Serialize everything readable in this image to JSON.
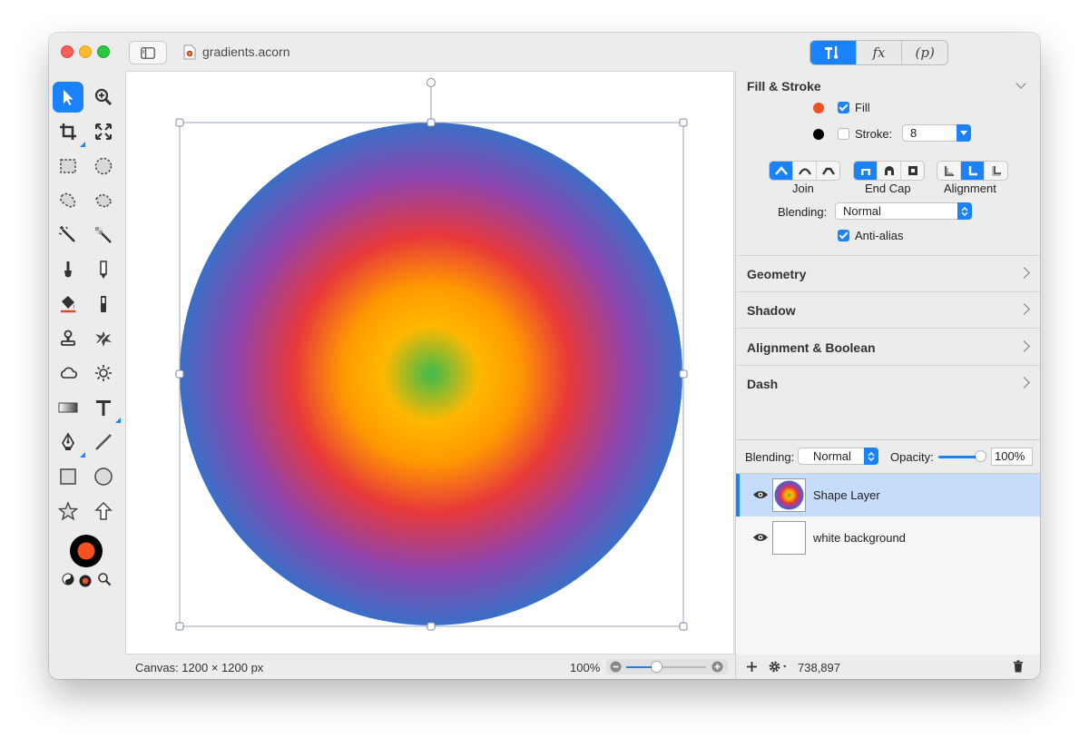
{
  "window": {
    "title": "gradients.acorn"
  },
  "inspector_tabs": [
    "T!",
    "fx",
    "(p)"
  ],
  "fill_stroke": {
    "title": "Fill & Stroke",
    "fill_label": "Fill",
    "fill_checked": true,
    "fill_color": "#f4511e",
    "stroke_label": "Stroke:",
    "stroke_checked": false,
    "stroke_color": "#000000",
    "stroke_width": "8",
    "join_label": "Join",
    "endcap_label": "End Cap",
    "alignment_label": "Alignment",
    "blending_label": "Blending:",
    "blending_value": "Normal",
    "antialias_label": "Anti-alias",
    "antialias_checked": true
  },
  "sections": [
    "Geometry",
    "Shadow",
    "Alignment & Boolean",
    "Dash"
  ],
  "layers_panel": {
    "blending_label": "Blending:",
    "blending_value": "Normal",
    "opacity_label": "Opacity:",
    "opacity_value": "100%",
    "opacity_fraction": 1.0,
    "layers": [
      {
        "name": "Shape Layer",
        "selected": true,
        "visible": true
      },
      {
        "name": "white background",
        "selected": false,
        "visible": true
      }
    ]
  },
  "status": {
    "canvas_size": "Canvas: 1200 × 1200 px",
    "zoom": "100%",
    "zoom_fraction": 0.38,
    "cursor_coords": "738,897"
  },
  "colors": {
    "accent": "#1a82fb",
    "foreground": "#f4511e",
    "background": "#000000",
    "gradient_center": "#3dbb4c",
    "gradient_mid": "#ffb800",
    "gradient_red": "#e8383a",
    "gradient_purple": "#8e44ad",
    "gradient_edge": "#3a6fc7"
  }
}
